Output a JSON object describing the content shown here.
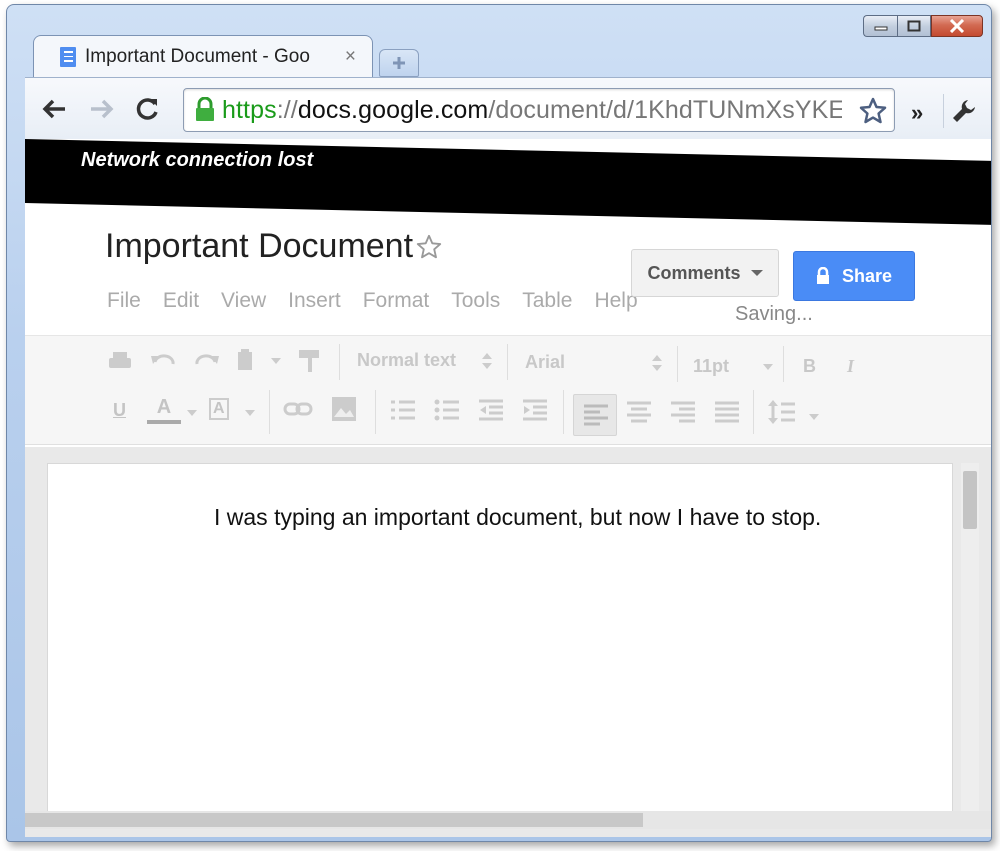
{
  "window": {
    "controls": {
      "minimize": "minimize",
      "maximize": "maximize",
      "close": "close"
    }
  },
  "tab": {
    "title": "Important Document - Goo",
    "close": "×",
    "favicon": "docs-icon"
  },
  "toolbar": {
    "url_scheme": "https",
    "url_sep": "://",
    "url_host": "docs.google.com",
    "url_path": "/document/d/1KhdTUNmXsYKE",
    "more": "»"
  },
  "banner": {
    "text": "Network connection lost"
  },
  "doc": {
    "title": "Important Document",
    "menu": [
      "File",
      "Edit",
      "View",
      "Insert",
      "Format",
      "Tools",
      "Table",
      "Help"
    ],
    "comments_label": "Comments",
    "share_label": "Share",
    "status": "Saving..."
  },
  "format_toolbar": {
    "style_select": "Normal text",
    "font_select": "Arial",
    "size_select": "11pt",
    "bold": "B",
    "italic": "I",
    "underline": "U",
    "text_color": "A",
    "highlight": "A"
  },
  "page": {
    "text": "I was typing an important document, but now I have to stop."
  },
  "colors": {
    "share_blue": "#4a8cf6",
    "url_green": "#1a9b1a",
    "banner_black": "#000000"
  }
}
